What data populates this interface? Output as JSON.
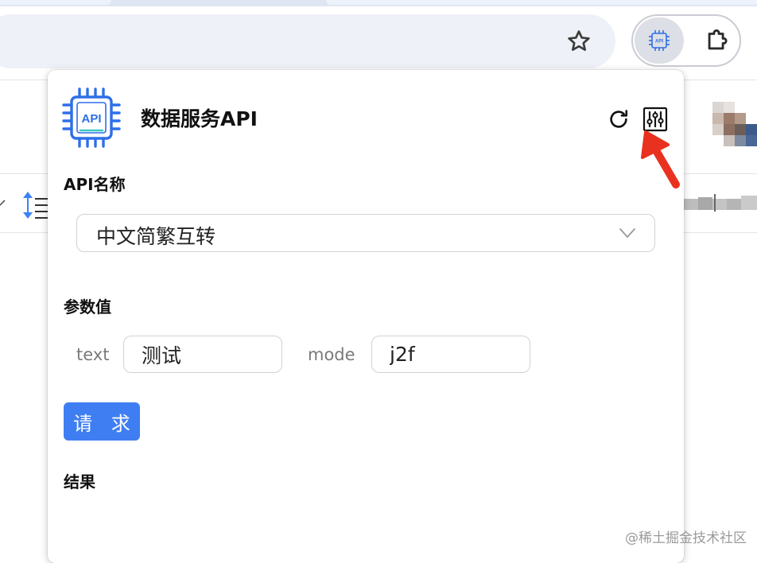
{
  "browser": {
    "bookmark_icon": "star-icon",
    "extension_icon": "api-chip-icon",
    "extensions_menu_icon": "puzzle-icon"
  },
  "popup": {
    "title": "数据服务API",
    "logo_text": "API",
    "refresh_icon": "refresh-icon",
    "settings_icon": "sliders-icon",
    "api_section_label": "API名称",
    "api_selected": "中文简繁互转",
    "params_section_label": "参数值",
    "params": [
      {
        "key": "text",
        "value": "测试"
      },
      {
        "key": "mode",
        "value": "j2f"
      }
    ],
    "request_button": "请 求",
    "result_section_label": "结果"
  },
  "colors": {
    "accent": "#3f7ef2",
    "logo_blue": "#2f6fe8",
    "annotation_red": "#e8321f"
  },
  "watermark": "@稀土掘金技术社区"
}
